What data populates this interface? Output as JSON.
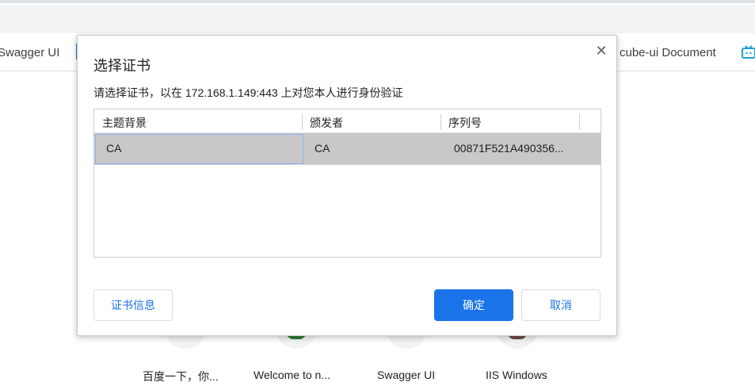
{
  "bookmarks": {
    "left_item": "Swagger UI",
    "right_item": "cube-ui Document",
    "right_icon": "tv-icon",
    "accent_color": "#1a73e8"
  },
  "shortcuts": [
    {
      "label": "百度一下，你..."
    },
    {
      "label": "Welcome to n..."
    },
    {
      "label": "Swagger UI"
    },
    {
      "label": "IIS Windows"
    }
  ],
  "dialog": {
    "title": "选择证书",
    "close_icon": "close-icon",
    "description": "请选择证书，以在 172.168.1.149:443 上对您本人进行身份验证",
    "table": {
      "columns": [
        "主题背景",
        "颁发者",
        "序列号"
      ],
      "rows": [
        {
          "subject": "CA",
          "issuer": "CA",
          "serial": "00871F521A490356..."
        }
      ]
    },
    "buttons": {
      "info": "证书信息",
      "ok": "确定",
      "cancel": "取消"
    }
  }
}
